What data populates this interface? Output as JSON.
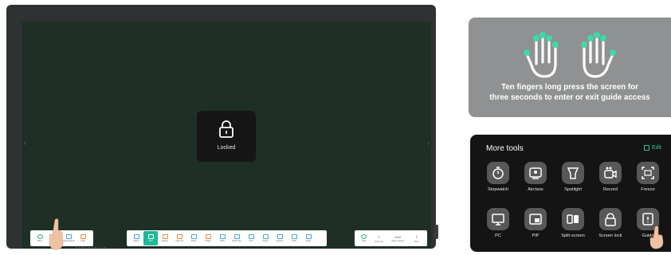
{
  "screen": {
    "lock_label": "Locked"
  },
  "toolbar_left": [
    {
      "label": "Menu",
      "icon": "menu-icon"
    },
    {
      "label": "App",
      "icon": "app-icon"
    },
    {
      "label": "Signal source",
      "icon": "signal-source-icon"
    },
    {
      "label": "Lock",
      "icon": "lock-icon"
    }
  ],
  "toolbar_center": [
    {
      "label": "Select",
      "icon": "select-icon"
    },
    {
      "label": "Pen",
      "icon": "pen-icon",
      "active": true
    },
    {
      "label": "Eraser",
      "icon": "eraser-icon"
    },
    {
      "label": "Clear all",
      "icon": "clear-all-icon"
    },
    {
      "label": "Ruler",
      "icon": "ruler-icon"
    },
    {
      "label": "Shape",
      "icon": "shape-icon"
    },
    {
      "label": "Table",
      "icon": "table-icon"
    },
    {
      "label": "Mind map",
      "icon": "mind-map-icon"
    },
    {
      "label": "Grid",
      "icon": "grid-icon"
    },
    {
      "label": "Notes",
      "icon": "notes-icon"
    },
    {
      "label": "Gesture",
      "icon": "gesture-icon"
    },
    {
      "label": "Undo",
      "icon": "undo-icon"
    },
    {
      "label": "Redo",
      "icon": "redo-icon"
    }
  ],
  "toolbar_right": {
    "add_label": "Add",
    "prev_label": "Previous",
    "page_value": "1/10",
    "page_label": "Page number",
    "next_label": "Next"
  },
  "guide": {
    "text": "Ten fingers long press the screen for\nthree seconds to enter or exit guide access",
    "accent_color": "#3fd9a7"
  },
  "more_tools": {
    "title": "More tools",
    "edit_label": "Edit",
    "accent_color": "#32c98e",
    "items": [
      {
        "label": "Stopwatch",
        "icon": "stopwatch-icon"
      },
      {
        "label": "Airclass",
        "icon": "airclass-icon"
      },
      {
        "label": "Spotlight",
        "icon": "spotlight-icon"
      },
      {
        "label": "Record",
        "icon": "record-icon"
      },
      {
        "label": "Freeze",
        "icon": "freeze-icon"
      },
      {
        "label": "PC",
        "icon": "pc-icon"
      },
      {
        "label": "PIP",
        "icon": "pip-icon"
      },
      {
        "label": "Split-screen",
        "icon": "split-screen-icon"
      },
      {
        "label": "Screen lock",
        "icon": "screen-lock-icon"
      },
      {
        "label": "Guide",
        "icon": "guide-icon"
      }
    ]
  }
}
